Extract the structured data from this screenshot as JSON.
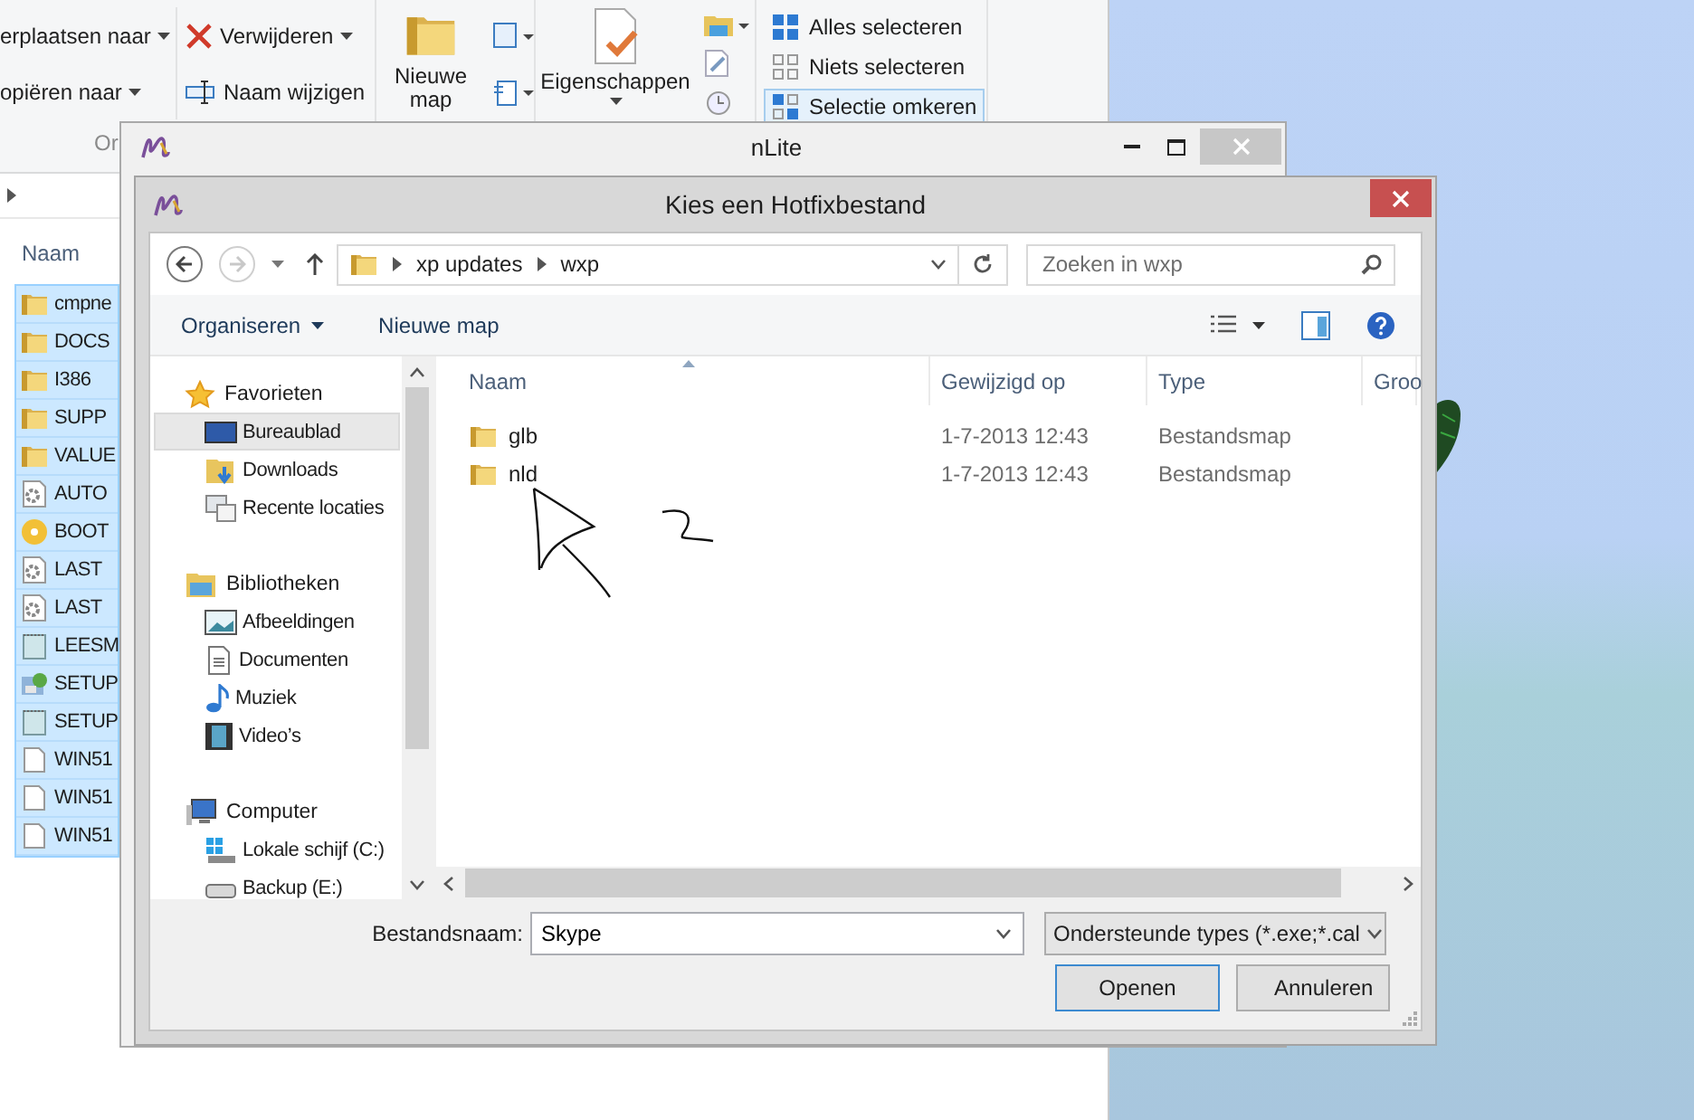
{
  "explorer": {
    "ribbon": {
      "clipboard_commands": [
        {
          "label": "erplaatsen naar",
          "dropdown": true
        },
        {
          "label": "opiëren naar",
          "dropdown": true
        }
      ],
      "edit_commands": [
        {
          "label": "Verwijderen",
          "kind": "delete",
          "dropdown": true
        },
        {
          "label": "Naam wijzigen",
          "kind": "rename",
          "dropdown": false
        }
      ],
      "new_folder": "Nieuwe map",
      "properties": "Eigenschappen",
      "select_commands": [
        {
          "label": "Alles selecteren",
          "kind": "select-all",
          "selected": false
        },
        {
          "label": "Niets selecteren",
          "kind": "select-none",
          "selected": false
        },
        {
          "label": "Selectie omkeren",
          "kind": "invert",
          "selected": true
        }
      ],
      "group_label": "Or"
    },
    "column_header": "Naam",
    "files": [
      {
        "name": "cmpne",
        "kind": "folder",
        "selected": true
      },
      {
        "name": "DOCS",
        "kind": "folder",
        "selected": true
      },
      {
        "name": "I386",
        "kind": "folder",
        "selected": true
      },
      {
        "name": "SUPP",
        "kind": "folder",
        "selected": true
      },
      {
        "name": "VALUE",
        "kind": "folder",
        "selected": true
      },
      {
        "name": "AUTO",
        "kind": "settings",
        "selected": true
      },
      {
        "name": "BOOT",
        "kind": "disc",
        "selected": true
      },
      {
        "name": "LAST",
        "kind": "settings",
        "selected": true
      },
      {
        "name": "LAST",
        "kind": "settings",
        "selected": true
      },
      {
        "name": "LEESM",
        "kind": "text",
        "selected": true
      },
      {
        "name": "SETUP",
        "kind": "setup",
        "selected": true
      },
      {
        "name": "SETUP",
        "kind": "text",
        "selected": true
      },
      {
        "name": "WIN51",
        "kind": "file",
        "selected": true
      },
      {
        "name": "WIN51",
        "kind": "file",
        "selected": true
      },
      {
        "name": "WIN51",
        "kind": "file",
        "selected": true
      }
    ]
  },
  "nlite_window": {
    "title": "nLite"
  },
  "dialog": {
    "title": "Kies een Hotfixbestand",
    "path": [
      "xp updates",
      "wxp"
    ],
    "search": {
      "placeholder": "Zoeken in wxp"
    },
    "toolbar": {
      "organize": "Organiseren",
      "new_folder": "Nieuwe map"
    },
    "sidebar": [
      {
        "label": "Favorieten",
        "kind": "star",
        "children": [
          {
            "label": "Bureaublad",
            "kind": "desktop",
            "selected": true
          },
          {
            "label": "Downloads",
            "kind": "download",
            "selected": false
          },
          {
            "label": "Recente locaties",
            "kind": "recent",
            "selected": false
          }
        ]
      },
      {
        "label": "Bibliotheken",
        "kind": "library",
        "children": [
          {
            "label": "Afbeeldingen",
            "kind": "pictures",
            "selected": false
          },
          {
            "label": "Documenten",
            "kind": "documents",
            "selected": false
          },
          {
            "label": "Muziek",
            "kind": "music",
            "selected": false
          },
          {
            "label": "Video’s",
            "kind": "video",
            "selected": false
          }
        ]
      },
      {
        "label": "Computer",
        "kind": "computer",
        "children": [
          {
            "label": "Lokale schijf (C:)",
            "kind": "system-drive",
            "selected": false
          },
          {
            "label": "Backup (E:)",
            "kind": "drive",
            "selected": false
          }
        ]
      }
    ],
    "columns": [
      {
        "label": "Naam",
        "sorted": true
      },
      {
        "label": "Gewijzigd op",
        "sorted": false
      },
      {
        "label": "Type",
        "sorted": false
      },
      {
        "label": "Groo",
        "sorted": false
      }
    ],
    "rows": [
      {
        "name": "glb",
        "modified": "1-7-2013 12:43",
        "type": "Bestandsmap"
      },
      {
        "name": "nld",
        "modified": "1-7-2013 12:43",
        "type": "Bestandsmap"
      }
    ],
    "file_name": {
      "label": "Bestandsnaam:",
      "value": "Skype"
    },
    "file_type": "Ondersteunde types (*.exe;*.cal",
    "buttons": [
      {
        "label": "Openen",
        "default": true
      },
      {
        "label": "Annuleren",
        "default": false
      }
    ]
  }
}
